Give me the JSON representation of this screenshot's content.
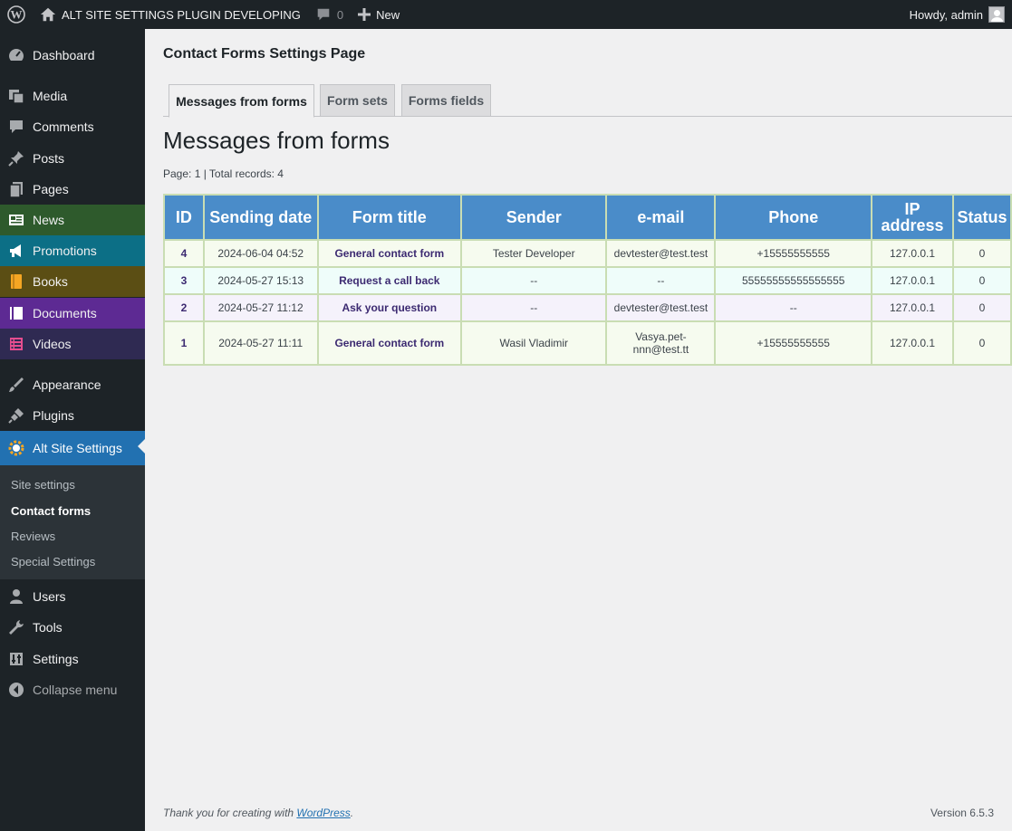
{
  "admin_bar": {
    "site_name": "ALT SITE SETTINGS PLUGIN DEVELOPING",
    "comments_count": "0",
    "new_label": "New",
    "greeting": "Howdy, admin"
  },
  "sidebar": {
    "items": [
      {
        "label": "Dashboard",
        "icon": "dashboard-icon"
      },
      {
        "label": "Media",
        "icon": "media-icon"
      },
      {
        "label": "Comments",
        "icon": "comments-icon"
      },
      {
        "label": "Posts",
        "icon": "pin-icon"
      },
      {
        "label": "Pages",
        "icon": "pages-icon"
      },
      {
        "label": "News",
        "icon": "news-icon",
        "bg": "#2e5a2c"
      },
      {
        "label": "Promotions",
        "icon": "megaphone-icon",
        "bg": "#0c6f86"
      },
      {
        "label": "Books",
        "icon": "book-icon",
        "bg": "#5b4e14"
      },
      {
        "label": "Documents",
        "icon": "document-icon",
        "bg": "#5d2a93"
      },
      {
        "label": "Videos",
        "icon": "video-icon",
        "bg": "#2f2a52"
      },
      {
        "label": "Appearance",
        "icon": "brush-icon"
      },
      {
        "label": "Plugins",
        "icon": "plugin-icon"
      },
      {
        "label": "Alt Site Settings",
        "icon": "gear-icon"
      },
      {
        "label": "Users",
        "icon": "users-icon"
      },
      {
        "label": "Tools",
        "icon": "wrench-icon"
      },
      {
        "label": "Settings",
        "icon": "settings-icon"
      },
      {
        "label": "Collapse menu",
        "icon": "collapse-icon"
      }
    ],
    "submenu": [
      "Site settings",
      "Contact forms",
      "Reviews",
      "Special Settings"
    ]
  },
  "main": {
    "settings_title": "Contact Forms Settings Page",
    "tabs": [
      {
        "label": "Messages from forms"
      },
      {
        "label": "Form sets"
      },
      {
        "label": "Forms fields"
      }
    ],
    "heading": "Messages from forms",
    "page_info": "Page: 1 | Total records: 4",
    "table": {
      "headers": [
        "ID",
        "Sending date",
        "Form title",
        "Sender",
        "e-mail",
        "Phone",
        "IP address",
        "Status"
      ],
      "rows": [
        [
          "4",
          "2024-06-04 04:52",
          "General contact form",
          "Tester Developer",
          "devtester@test.test",
          "+15555555555",
          "127.0.0.1",
          "0"
        ],
        [
          "3",
          "2024-05-27 15:13",
          "Request a call back",
          "--",
          "--",
          "55555555555555555",
          "127.0.0.1",
          "0"
        ],
        [
          "2",
          "2024-05-27 11:12",
          "Ask your question",
          "--",
          "devtester@test.test",
          "--",
          "127.0.0.1",
          "0"
        ],
        [
          "1",
          "2024-05-27 11:11",
          "General contact form",
          "Wasil Vladimir",
          "Vasya.pet-nnn@test.tt",
          "+15555555555",
          "127.0.0.1",
          "0"
        ]
      ]
    }
  },
  "footer": {
    "thanks_prefix": "Thank you for creating with ",
    "thanks_link": "WordPress",
    "thanks_suffix": ".",
    "version": "Version 6.5.3"
  },
  "colors": {
    "header_blue": "#4a8cc9",
    "accent": "#2271b1",
    "sidebar_bg": "#1d2327"
  }
}
